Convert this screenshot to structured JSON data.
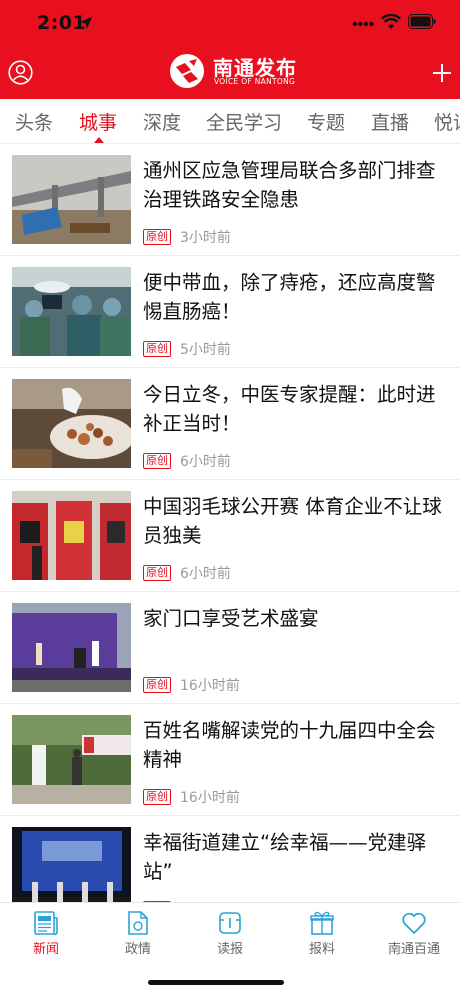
{
  "status": {
    "time": "2:01"
  },
  "app": {
    "name": "南通发布",
    "subtitle": "VOICE OF NANTONG",
    "brand_color": "#e8101e"
  },
  "tabs": [
    {
      "label": "头条",
      "active": false
    },
    {
      "label": "城事",
      "active": true
    },
    {
      "label": "深度",
      "active": false
    },
    {
      "label": "全民学习",
      "active": false
    },
    {
      "label": "专题",
      "active": false
    },
    {
      "label": "直播",
      "active": false
    },
    {
      "label": "悦读",
      "active": false
    }
  ],
  "news": [
    {
      "title": "通州区应急管理局联合多部门排查治理铁路安全隐患",
      "badge": "原创",
      "time": "3小时前",
      "image": "railway-bridge-photo"
    },
    {
      "title": "便中带血，除了痔疮，还应高度警惕直肠癌！",
      "badge": "原创",
      "time": "5小时前",
      "image": "surgery-room-photo"
    },
    {
      "title": "今日立冬，中医专家提醒：此时进补正当时！",
      "badge": "原创",
      "time": "6小时前",
      "image": "herbal-medicine-photo"
    },
    {
      "title": "中国羽毛球公开赛 体育企业不让球员独美",
      "badge": "原创",
      "time": "6小时前",
      "image": "jersey-display-photo"
    },
    {
      "title": "家门口享受艺术盛宴",
      "badge": "原创",
      "time": "16小时前",
      "image": "stage-performance-photo"
    },
    {
      "title": "百姓名嘴解读党的十九届四中全会精神",
      "badge": "原创",
      "time": "16小时前",
      "image": "outdoor-speech-photo"
    },
    {
      "title": "幸福街道建立“绘幸福——党建驿站”",
      "badge": "原创",
      "time": "",
      "image": "ceremony-stage-photo"
    }
  ],
  "bottom_nav": [
    {
      "label": "新闻",
      "icon": "newspaper-icon",
      "active": true
    },
    {
      "label": "政情",
      "icon": "document-icon",
      "active": false
    },
    {
      "label": "读报",
      "icon": "paper-reader-icon",
      "active": false
    },
    {
      "label": "报料",
      "icon": "gift-box-icon",
      "active": false
    },
    {
      "label": "南通百通",
      "icon": "heart-icon",
      "active": false
    }
  ]
}
